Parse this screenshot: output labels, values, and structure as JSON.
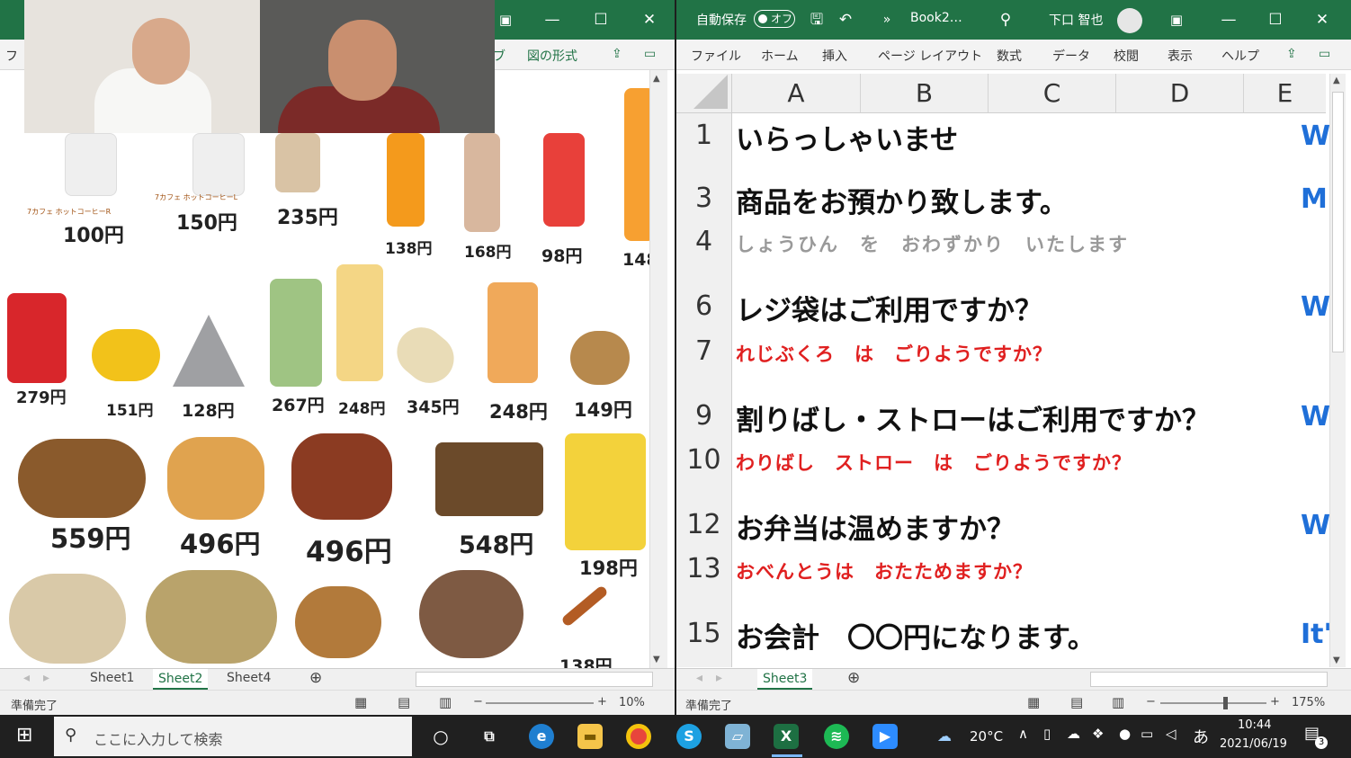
{
  "left_window": {
    "ribbon_tab": "図の形式",
    "sheet_tabs": [
      "Sheet1",
      "Sheet2",
      "Sheet4"
    ],
    "active_tab": "Sheet2",
    "status": "準備完了",
    "zoom": "10%",
    "products": [
      {
        "label": "7カフェ ホットコーヒーR",
        "price": "100円"
      },
      {
        "label": "7カフェ ホットコーヒーL",
        "price": "150円"
      },
      {
        "price": "235円"
      },
      {
        "price": "138円"
      },
      {
        "price": "168円"
      },
      {
        "price": "98円"
      },
      {
        "price": "148"
      },
      {
        "price": "279円"
      },
      {
        "price": "151円"
      },
      {
        "price": "128円"
      },
      {
        "price": "267円"
      },
      {
        "price": "248円"
      },
      {
        "price": "345円"
      },
      {
        "price": "248円"
      },
      {
        "price": "149円"
      },
      {
        "price": "559円"
      },
      {
        "price": "496円"
      },
      {
        "price": "496円"
      },
      {
        "price": "548円"
      },
      {
        "price": "198円"
      },
      {
        "price": "138円"
      }
    ]
  },
  "right_window": {
    "autosave_label": "自動保存",
    "autosave_state": "オフ",
    "filename": "Book2…",
    "user": "下口 智也",
    "ribbon_tabs": [
      "ファイル",
      "ホーム",
      "挿入",
      "ページ レイアウト",
      "数式",
      "データ",
      "校閲",
      "表示",
      "ヘルプ"
    ],
    "columns": [
      "A",
      "B",
      "C",
      "D",
      "E"
    ],
    "rows": [
      {
        "num": "1",
        "text": "いらっしゃいませ",
        "style": "big",
        "trail": "W"
      },
      {
        "num": "3",
        "text": "商品をお預かり致します。",
        "style": "big",
        "trail": "M"
      },
      {
        "num": "4",
        "text": "しょうひん　を　おわずかり　いたします",
        "style": "gray",
        "trail": ""
      },
      {
        "num": "6",
        "text": "レジ袋はご利用ですか？",
        "style": "big",
        "trail": "W"
      },
      {
        "num": "7",
        "text": "れじぶくろ　は　ごりようですか？",
        "style": "red",
        "trail": ""
      },
      {
        "num": "9",
        "text": "割りばし・ストローはご利用ですか？",
        "style": "big",
        "trail": "W"
      },
      {
        "num": "10",
        "text": "わりばし　ストロー　は　ごりようですか？",
        "style": "red",
        "trail": ""
      },
      {
        "num": "12",
        "text": "お弁当は温めますか？",
        "style": "big",
        "trail": "W"
      },
      {
        "num": "13",
        "text": "おべんとうは　おたためますか？",
        "style": "red",
        "trail": ""
      },
      {
        "num": "15",
        "text": "お会計　〇〇円になります。",
        "style": "big",
        "trail": "It'"
      }
    ],
    "sheet_tab": "Sheet3",
    "status": "準備完了",
    "zoom": "175%"
  },
  "taskbar": {
    "search_placeholder": "ここに入力して検索",
    "temperature": "20°C",
    "ime": "あ",
    "time": "10:44",
    "date": "2021/06/19",
    "notifications": "3"
  }
}
